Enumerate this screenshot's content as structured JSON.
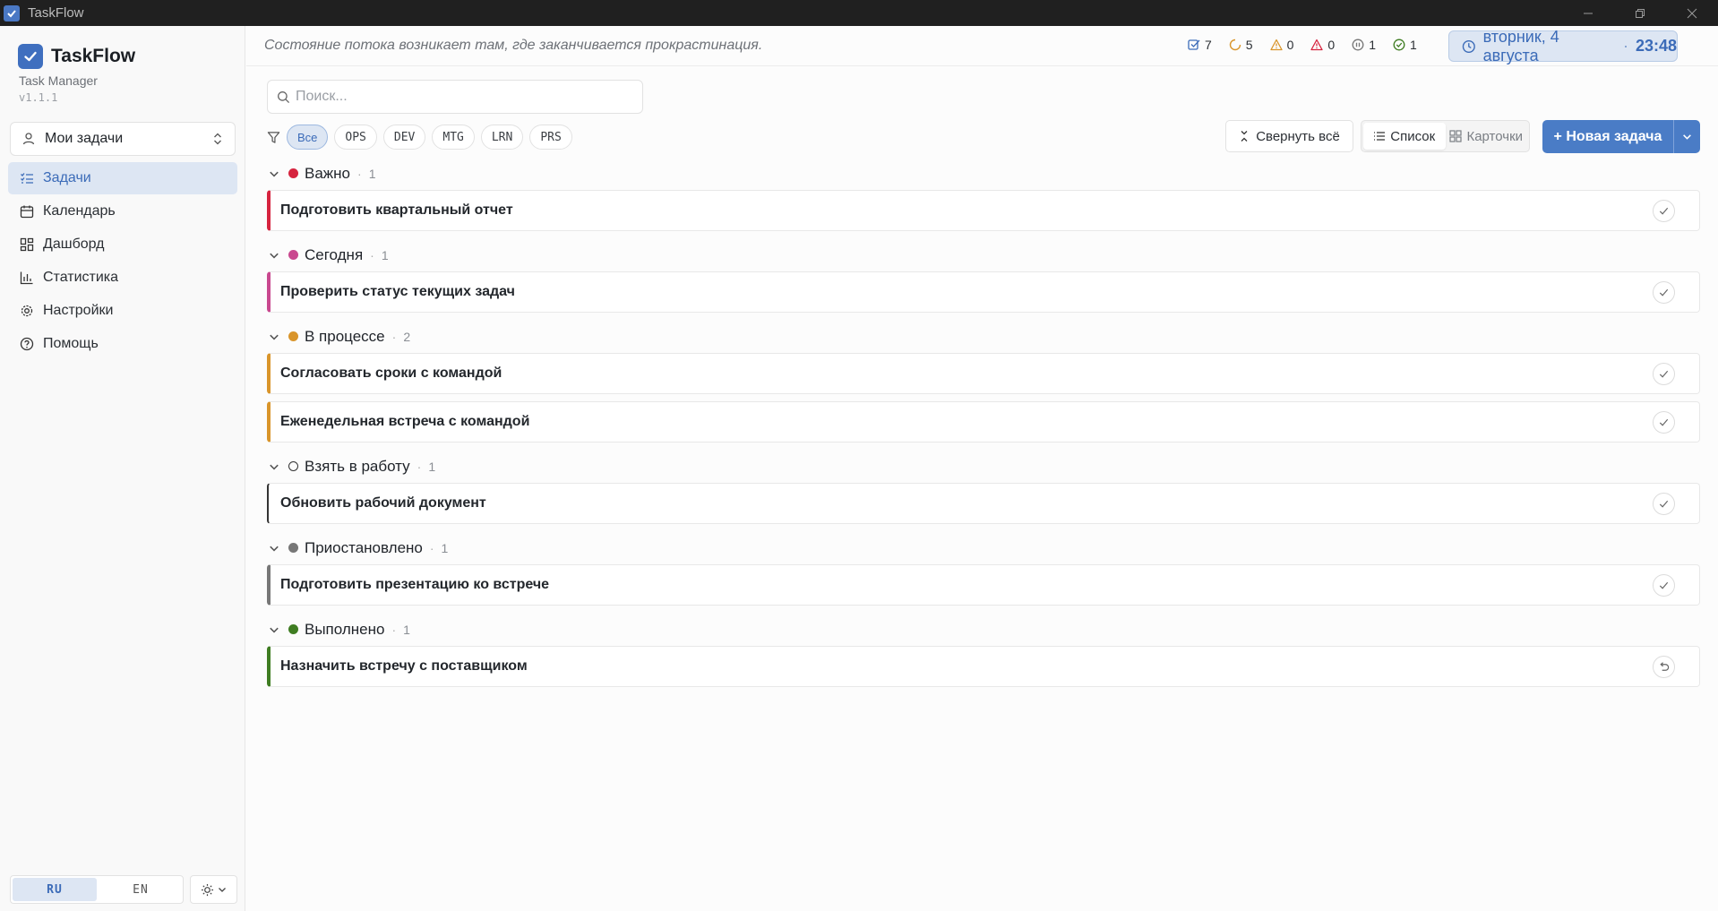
{
  "window": {
    "title": "TaskFlow"
  },
  "sidebar": {
    "brand": "TaskFlow",
    "subtitle": "Task Manager",
    "version": "v1.1.1",
    "user_select": "Мои задачи",
    "items": [
      {
        "label": "Задачи",
        "icon": "list-check-icon",
        "active": true
      },
      {
        "label": "Календарь",
        "icon": "calendar-icon"
      },
      {
        "label": "Дашборд",
        "icon": "dashboard-icon"
      },
      {
        "label": "Статистика",
        "icon": "bar-chart-icon"
      },
      {
        "label": "Настройки",
        "icon": "gear-icon"
      },
      {
        "label": "Помощь",
        "icon": "help-circle-icon"
      }
    ],
    "lang_ru": "RU",
    "lang_en": "EN"
  },
  "header": {
    "quote": "Состояние потока возникает там, где заканчивается прокрастинация.",
    "stats": {
      "total": "7",
      "in_progress": "5",
      "warning": "0",
      "overdue": "0",
      "paused": "1",
      "done": "1"
    },
    "date": "вторник, 4 августа",
    "time": "23:48"
  },
  "toolbar": {
    "search_placeholder": "Поиск...",
    "filters": [
      "Все",
      "OPS",
      "DEV",
      "MTG",
      "LRN",
      "PRS"
    ],
    "collapse_label": "Свернуть всё",
    "view_list": "Список",
    "view_cards": "Карточки",
    "new_task": "+ Новая задача"
  },
  "colors": {
    "accent": "#4a7cc6",
    "important": "#d6243f",
    "today": "#c9488f",
    "in_progress": "#d9952b",
    "todo": "#333333",
    "paused": "#777777",
    "done": "#3f7d22"
  },
  "groups": [
    {
      "name": "Важно",
      "count": "1",
      "tasks": [
        "Подготовить квартальный отчет"
      ]
    },
    {
      "name": "Сегодня",
      "count": "1",
      "tasks": [
        "Проверить статус текущих задач"
      ]
    },
    {
      "name": "В процессе",
      "count": "2",
      "tasks": [
        "Согласовать сроки с командой",
        "Еженедельная встреча с командой"
      ]
    },
    {
      "name": "Взять в работу",
      "count": "1",
      "tasks": [
        "Обновить рабочий документ"
      ]
    },
    {
      "name": "Приостановлено",
      "count": "1",
      "tasks": [
        "Подготовить презентацию ко встрече"
      ]
    },
    {
      "name": "Выполнено",
      "count": "1",
      "tasks": [
        "Назначить встречу с поставщиком"
      ]
    }
  ]
}
